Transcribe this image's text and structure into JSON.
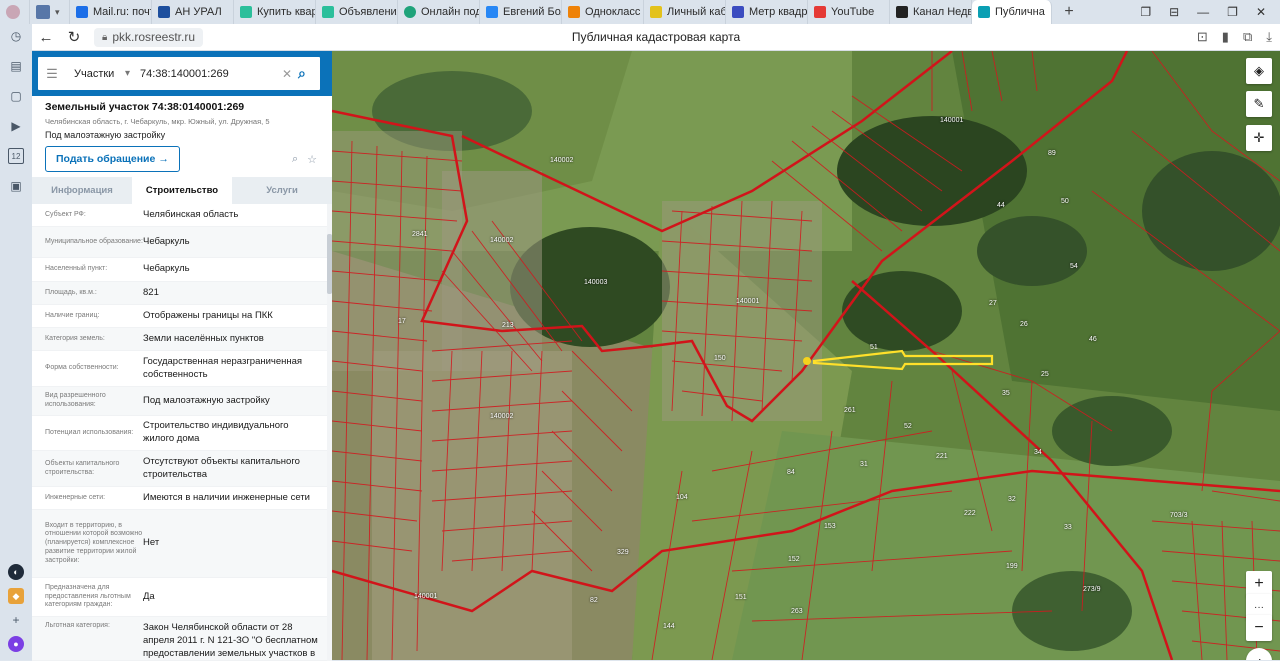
{
  "browser": {
    "tabs": [
      {
        "label": "",
        "color": "#6b7c8f"
      },
      {
        "label": "Mail.ru: почт",
        "color": "#1c6ee8"
      },
      {
        "label": "АН УРАЛ",
        "color": "#1d4f9e"
      },
      {
        "label": "Купить квар",
        "color": "#2bbf9b"
      },
      {
        "label": "Объявления",
        "color": "#2bbf9b"
      },
      {
        "label": "Онлайн под",
        "color": "#1fa37a"
      },
      {
        "label": "Евгений Бол",
        "color": "#2787f5"
      },
      {
        "label": "Однокласс",
        "color": "#ee8208"
      },
      {
        "label": "Личный каб",
        "color": "#e3c21c"
      },
      {
        "label": "Метр квадр",
        "color": "#3b4cc0"
      },
      {
        "label": "YouTube",
        "color": "#e53935"
      },
      {
        "label": "Канал Недв",
        "color": "#222222"
      },
      {
        "label": "Публична",
        "color": "#0b9fb3",
        "close": "×"
      }
    ],
    "new_tab": "+",
    "url": "pkk.rosreestr.ru",
    "page_title": "Публичная кадастровая карта",
    "rail_number": "12"
  },
  "panel": {
    "search_type": "Участки",
    "search_query": "74:38:140001:269",
    "object_title": "Земельный участок 74:38:0140001:269",
    "object_address": "Челябинская область, г. Чебаркуль, мкр. Южный, ул. Дружная, 5",
    "object_use": "Под малоэтажную застройку",
    "appeal_button": "Подать обращение",
    "tabs": [
      "Информация",
      "Строительство",
      "Услуги"
    ],
    "rows": [
      {
        "k": "Субъект РФ:",
        "v": "Челябинская область"
      },
      {
        "k": "Муниципальное образование:",
        "v": "Чебаркуль"
      },
      {
        "k": "Населенный пункт:",
        "v": "Чебаркуль"
      },
      {
        "k": "Площадь, кв.м.:",
        "v": "821"
      },
      {
        "k": "Наличие границ:",
        "v": "Отображены границы на ПКК"
      },
      {
        "k": "Категория земель:",
        "v": "Земли населённых пунктов"
      },
      {
        "k": "Форма собственности:",
        "v": "Государственная неразграниченная собственность"
      },
      {
        "k": "Вид разрешенного использования:",
        "v": "Под малоэтажную застройку"
      },
      {
        "k": "Потенциал использования:",
        "v": "Строительство индивидуального жилого дома"
      },
      {
        "k": "Объекты капитального строительства:",
        "v": "Отсутствуют объекты капитального строительства"
      },
      {
        "k": "Инженерные сети:",
        "v": "Имеются в наличии инженерные сети"
      },
      {
        "k": "Входит в территорию, в отношении которой возможно (планируется) комплексное развитие территории жилой застройки:",
        "v": "Нет"
      },
      {
        "k": "Предназначена для предоставления льготным категориям граждан:",
        "v": "Да"
      },
      {
        "k": "Льготная категория:",
        "v": "Закон Челябинской области от 28 апреля 2011 г. N 121-ЗО \"О бесплатном предоставлении земельных участков в"
      }
    ]
  },
  "map": {
    "labels": [
      "140003",
      "140002",
      "140001",
      "140002",
      "140001",
      "140002",
      "140001",
      "213",
      "2841",
      "51",
      "27",
      "26",
      "46",
      "25",
      "35",
      "34",
      "44",
      "50",
      "54",
      "89",
      "52",
      "221",
      "222",
      "32",
      "33",
      "199",
      "261",
      "104",
      "153",
      "152",
      "151",
      "263",
      "144",
      "82",
      "329",
      "84",
      "31",
      "150",
      "17",
      "273/9",
      "703/3"
    ],
    "tools": {
      "layers": "layers-icon",
      "ruler": "ruler-icon",
      "locate": "locate-icon",
      "zoom_in": "+",
      "more": "···",
      "zoom_out": "−"
    }
  }
}
